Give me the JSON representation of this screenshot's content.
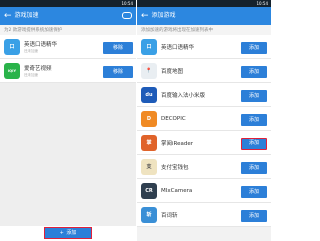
{
  "left": {
    "status_time": "10:54",
    "title": "游戏加速",
    "back_glyph": "←",
    "hint": "为2 款游戏提供系统加速保护",
    "apps": [
      {
        "name": "英语口语精华",
        "sub": "还未加速",
        "action": "移除",
        "icon_color": "#3aa0e6",
        "icon_text": "口"
      },
      {
        "name": "爱奇艺视频",
        "sub": "还未加速",
        "action": "移除",
        "icon_color": "#2ab34a",
        "icon_text": "iQIY"
      }
    ],
    "add_button": {
      "plus": "+",
      "label": "添加"
    }
  },
  "right": {
    "status_time": "10:54",
    "title": "添加游戏",
    "back_glyph": "←",
    "hint": "添加加速的游戏将出现在加速列表中",
    "apps": [
      {
        "name": "英语口语精华",
        "action": "添加",
        "icon_color": "#3aa0e6",
        "icon_text": "口"
      },
      {
        "name": "百度地图",
        "action": "添加",
        "icon_color": "#e9eef2",
        "icon_text": "📍"
      },
      {
        "name": "百度输入法小米版",
        "action": "添加",
        "icon_color": "#1e5bb8",
        "icon_text": "du"
      },
      {
        "name": "DECOPIC",
        "action": "添加",
        "icon_color": "#f08a24",
        "icon_text": "D"
      },
      {
        "name": "掌阅iReader",
        "action": "添加",
        "icon_color": "#e0632a",
        "icon_text": "掌"
      },
      {
        "name": "支付宝钱包",
        "action": "添加",
        "icon_color": "#efe3c0",
        "icon_text": "支"
      },
      {
        "name": "MIxCamera",
        "action": "添加",
        "icon_color": "#2f3f4f",
        "icon_text": "CR"
      },
      {
        "name": "百词斩",
        "action": "添加",
        "icon_color": "#3a8fd6",
        "icon_text": "斩"
      }
    ]
  }
}
